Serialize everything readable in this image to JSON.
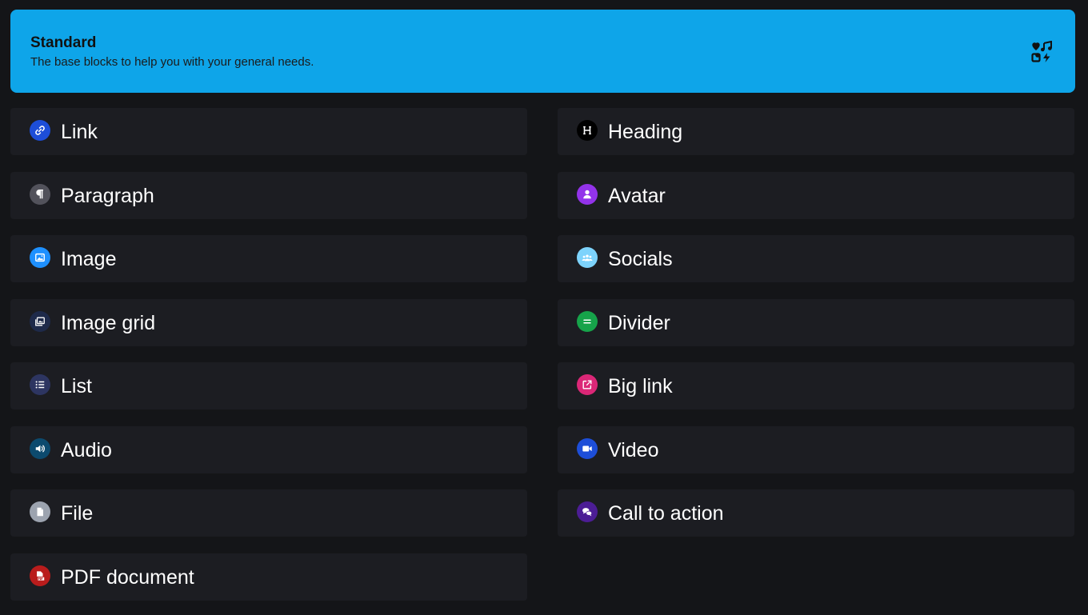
{
  "header": {
    "title": "Standard",
    "description": "The base blocks to help you with your general needs.",
    "icon": "shapes-icon"
  },
  "blocks": {
    "link": {
      "label": "Link",
      "icon": "link-icon",
      "color": "#1d4ed8"
    },
    "paragraph": {
      "label": "Paragraph",
      "icon": "pilcrow-icon",
      "color": "#52525b"
    },
    "image": {
      "label": "Image",
      "icon": "image-icon",
      "color": "#1e90ff"
    },
    "image_grid": {
      "label": "Image grid",
      "icon": "images-icon",
      "color": "#1e2a4a"
    },
    "list": {
      "label": "List",
      "icon": "list-icon",
      "color": "#2d3561"
    },
    "audio": {
      "label": "Audio",
      "icon": "speaker-icon",
      "color": "#0c4a6e"
    },
    "file": {
      "label": "File",
      "icon": "file-icon",
      "color": "#9ca3af"
    },
    "pdf": {
      "label": "PDF document",
      "icon": "pdf-icon",
      "color": "#b91c1c"
    },
    "heading": {
      "label": "Heading",
      "icon": "heading-icon",
      "color": "#000000"
    },
    "avatar": {
      "label": "Avatar",
      "icon": "user-icon",
      "color": "#9333ea"
    },
    "socials": {
      "label": "Socials",
      "icon": "people-icon",
      "color": "#7dd3fc"
    },
    "divider": {
      "label": "Divider",
      "icon": "equals-icon",
      "color": "#16a34a"
    },
    "big_link": {
      "label": "Big link",
      "icon": "external-link-icon",
      "color": "#db2777"
    },
    "video": {
      "label": "Video",
      "icon": "video-camera-icon",
      "color": "#1d4ed8"
    },
    "cta": {
      "label": "Call to action",
      "icon": "chat-bubbles-icon",
      "color": "#4c1d95"
    }
  }
}
